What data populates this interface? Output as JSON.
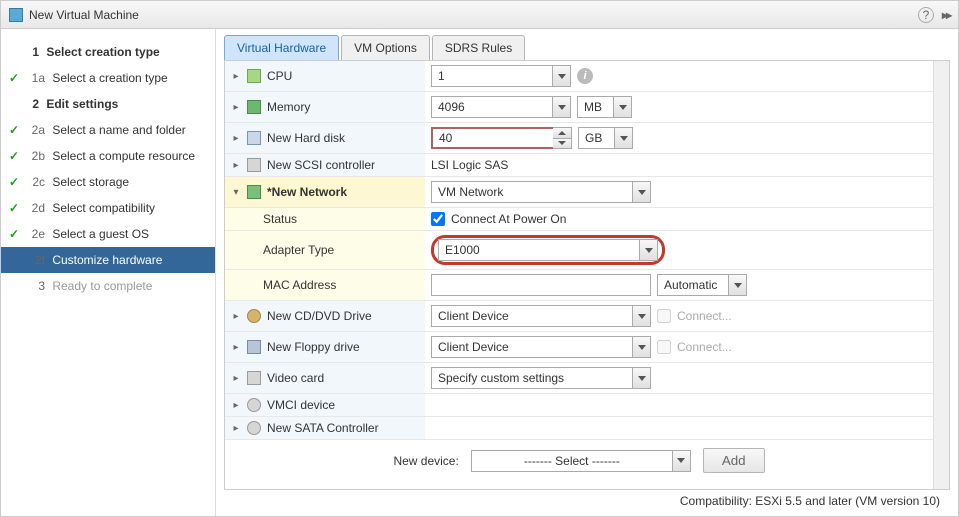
{
  "title": "New Virtual Machine",
  "sidebar": {
    "items": [
      {
        "num": "1",
        "label": "Select creation type",
        "cls": "section"
      },
      {
        "num": "1a",
        "label": "Select a creation type",
        "cls": "done"
      },
      {
        "num": "2",
        "label": "Edit settings",
        "cls": "section"
      },
      {
        "num": "2a",
        "label": "Select a name and folder",
        "cls": "done"
      },
      {
        "num": "2b",
        "label": "Select a compute resource",
        "cls": "done"
      },
      {
        "num": "2c",
        "label": "Select storage",
        "cls": "done"
      },
      {
        "num": "2d",
        "label": "Select compatibility",
        "cls": "done"
      },
      {
        "num": "2e",
        "label": "Select a guest OS",
        "cls": "done"
      },
      {
        "num": "2f",
        "label": "Customize hardware",
        "cls": "current"
      },
      {
        "num": "3",
        "label": "Ready to complete",
        "cls": "disabled"
      }
    ]
  },
  "tabs": [
    "Virtual Hardware",
    "VM Options",
    "SDRS Rules"
  ],
  "hw": {
    "cpu": {
      "label": "CPU",
      "value": "1"
    },
    "memory": {
      "label": "Memory",
      "value": "4096",
      "unit": "MB"
    },
    "disk": {
      "label": "New Hard disk",
      "value": "40",
      "unit": "GB"
    },
    "scsi": {
      "label": "New SCSI controller",
      "value": "LSI Logic SAS"
    },
    "net": {
      "label": "*New Network",
      "value": "VM Network",
      "status": {
        "label": "Status",
        "chk": "Connect At Power On"
      },
      "adapter": {
        "label": "Adapter Type",
        "value": "E1000"
      },
      "mac": {
        "label": "MAC Address",
        "value": "",
        "mode": "Automatic"
      }
    },
    "cd": {
      "label": "New CD/DVD Drive",
      "value": "Client Device",
      "connect": "Connect..."
    },
    "floppy": {
      "label": "New Floppy drive",
      "value": "Client Device",
      "connect": "Connect..."
    },
    "video": {
      "label": "Video card",
      "value": "Specify custom settings"
    },
    "vmci": {
      "label": "VMCI device"
    },
    "sata": {
      "label": "New SATA Controller"
    }
  },
  "newdev": {
    "label": "New device:",
    "select": "------- Select -------",
    "add": "Add"
  },
  "footer": "Compatibility: ESXi 5.5 and later (VM version 10)",
  "help": "?"
}
